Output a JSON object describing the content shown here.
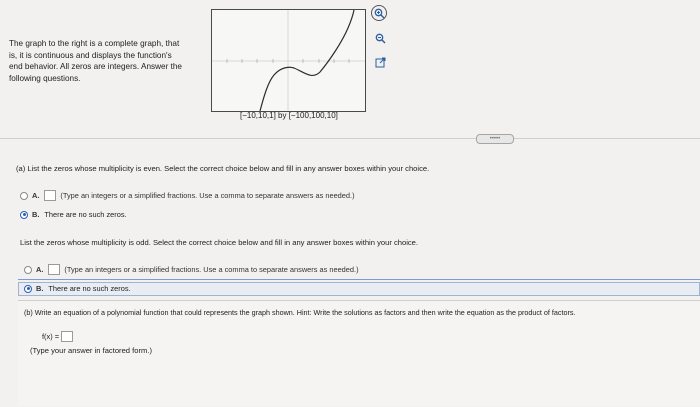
{
  "intro": {
    "lines": [
      "The graph to the right is a complete graph, that",
      "is, it is continuous and displays the function's",
      "end behavior. All zeros are integers. Answer the",
      "following questions."
    ]
  },
  "graph": {
    "window_label": "[−10,10,1] by [−100,100,10]"
  },
  "tools": {
    "zoom_in_icon": "magnifier-plus",
    "zoom_out_icon": "magnifier-minus",
    "popout_icon": "external-link"
  },
  "more_pill": "•••••",
  "part_a": {
    "question": "(a) List the zeros whose multiplicity is even. Select the correct choice below and fill in any answer boxes within your choice.",
    "option_a_letter": "A.",
    "option_a_hint": "(Type an integers or a simplified fractions. Use a comma to separate answers as needed.)",
    "option_b_letter": "B.",
    "option_b_text": "There are no such zeros."
  },
  "part_a2": {
    "question": "List the zeros whose multiplicity is odd. Select the correct choice below and fill in any answer boxes within your choice.",
    "option_a_letter": "A.",
    "option_a_hint": "(Type an integers or a simplified fractions. Use a comma to separate answers as needed.)",
    "option_b_letter": "B.",
    "option_b_text": "There are no such zeros."
  },
  "part_b": {
    "question": "(b) Write an equation of a polynomial function that could represents the graph shown. Hint: Write the solutions as factors and then write the equation as the product of factors.",
    "fx_label": "f(x) =",
    "hint": "(Type your answer in factored form.)"
  },
  "colors": {
    "accent": "#2a5fb0",
    "background": "#f2f1ef"
  }
}
